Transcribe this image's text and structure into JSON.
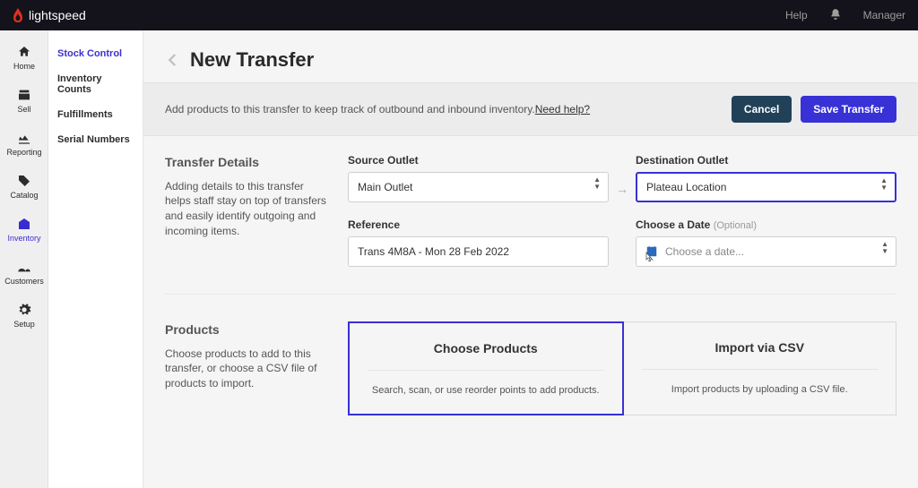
{
  "brand": {
    "name": "lightspeed"
  },
  "topnav": {
    "help": "Help",
    "role": "Manager"
  },
  "primaryNav": {
    "home": "Home",
    "sell": "Sell",
    "reporting": "Reporting",
    "catalog": "Catalog",
    "inventory": "Inventory",
    "customers": "Customers",
    "setup": "Setup"
  },
  "secondaryNav": {
    "items": [
      "Stock Control",
      "Inventory Counts",
      "Fulfillments",
      "Serial Numbers"
    ],
    "activeIndex": 0
  },
  "page": {
    "title": "New Transfer",
    "hint_prefix": "Add products to this transfer to keep track of outbound and inbound inventory. ",
    "hint_link": "Need help?",
    "cancel": "Cancel",
    "save": "Save Transfer"
  },
  "transferDetails": {
    "heading": "Transfer Details",
    "desc": "Adding details to this transfer helps staff stay on top of transfers and easily identify outgoing and incoming items.",
    "sourceLabel": "Source Outlet",
    "sourceValue": "Main Outlet",
    "destLabel": "Destination Outlet",
    "destValue": "Plateau Location",
    "refLabel": "Reference",
    "refValue": "Trans 4M8A - Mon 28 Feb 2022",
    "dateLabel": "Choose a Date",
    "dateOptional": "(Optional)",
    "datePlaceholder": "Choose a date..."
  },
  "products": {
    "heading": "Products",
    "desc": "Choose products to add to this transfer, or choose a CSV file of products to import.",
    "tileChooseTitle": "Choose Products",
    "tileChooseDesc": "Search, scan, or use reorder points to add products.",
    "tileImportTitle": "Import via CSV",
    "tileImportDesc": "Import products by uploading a CSV file."
  }
}
